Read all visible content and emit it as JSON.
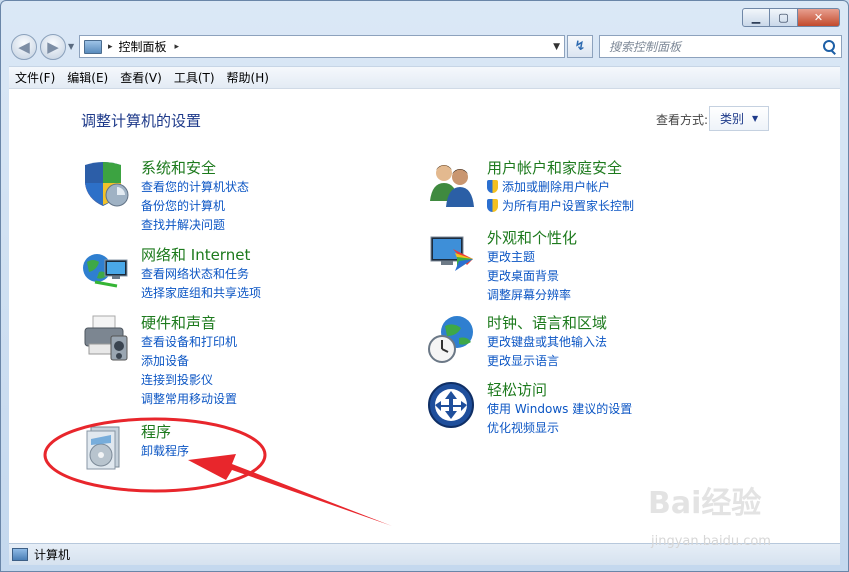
{
  "window": {
    "buttons": {
      "minimize": "▁",
      "maximize": "▢",
      "close": "✕"
    }
  },
  "nav": {
    "back_icon": "◀",
    "forward_icon": "▶",
    "address": {
      "root_arrow": "▸",
      "location": "控制面板",
      "trail_arrow": "▸",
      "dropdown": "▼"
    },
    "refresh_icon": "↯",
    "search_placeholder": "搜索控制面板"
  },
  "menubar": [
    "文件(F)",
    "编辑(E)",
    "查看(V)",
    "工具(T)",
    "帮助(H)"
  ],
  "main": {
    "title": "调整计算机的设置",
    "view_by_label": "查看方式:",
    "view_by_value": "类别",
    "view_by_caret": "▼",
    "categories_left": [
      {
        "icon": "shield-icon",
        "title": "系统和安全",
        "links": [
          "查看您的计算机状态",
          "备份您的计算机",
          "查找并解决问题"
        ]
      },
      {
        "icon": "network-icon",
        "title": "网络和 Internet",
        "links": [
          "查看网络状态和任务",
          "选择家庭组和共享选项"
        ]
      },
      {
        "icon": "printer-icon",
        "title": "硬件和声音",
        "links": [
          "查看设备和打印机",
          "添加设备",
          "连接到投影仪",
          "调整常用移动设置"
        ]
      },
      {
        "icon": "programs-icon",
        "title": "程序",
        "links": [
          "卸载程序"
        ]
      }
    ],
    "categories_right": [
      {
        "icon": "users-icon",
        "title": "用户帐户和家庭安全",
        "links": [
          "添加或删除用户帐户",
          "为所有用户设置家长控制"
        ],
        "shield_links": true
      },
      {
        "icon": "appearance-icon",
        "title": "外观和个性化",
        "links": [
          "更改主题",
          "更改桌面背景",
          "调整屏幕分辨率"
        ]
      },
      {
        "icon": "clock-globe-icon",
        "title": "时钟、语言和区域",
        "links": [
          "更改键盘或其他输入法",
          "更改显示语言"
        ]
      },
      {
        "icon": "ease-of-access-icon",
        "title": "轻松访问",
        "links": [
          "使用 Windows 建议的设置",
          "优化视频显示"
        ]
      }
    ]
  },
  "statusbar": {
    "text": "计算机"
  },
  "annotation_color": "#e8262c",
  "watermark": {
    "main": "Bai经验",
    "sub": "jingyan.baidu.com"
  }
}
